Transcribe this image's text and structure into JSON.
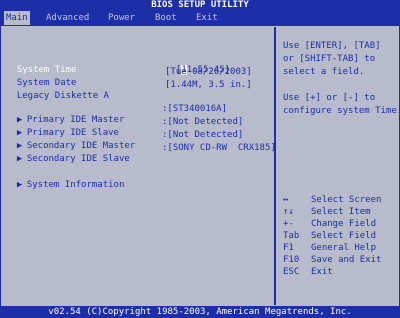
{
  "title": "BIOS SETUP UTILITY",
  "menu": [
    {
      "label": "Main",
      "active": true
    },
    {
      "label": "Advanced"
    },
    {
      "label": "Power"
    },
    {
      "label": "Boot"
    },
    {
      "label": "Exit"
    }
  ],
  "main": {
    "system_time_label": "System Time",
    "system_time_cursor": "1",
    "system_time_rest": "1:55:45",
    "system_date_label": "System Date",
    "system_date_value": "[Tue 08/26/2003]",
    "legacy_diskette_label": "Legacy Diskette A",
    "legacy_diskette_value": "[1.44M, 3.5 in.]",
    "ide": [
      {
        "label": "Primary IDE Master",
        "value": ":[ST340016A]"
      },
      {
        "label": "Primary IDE Slave",
        "value": ":[Not Detected]"
      },
      {
        "label": "Secondary IDE Master",
        "value": ":[Not Detected]"
      },
      {
        "label": "Secondary IDE Slave",
        "value": ":[SONY CD-RW  CRX185]"
      }
    ],
    "system_information_label": "System Information"
  },
  "help": {
    "line1": "Use [ENTER], [TAB]",
    "line2": "or [SHIFT-TAB] to",
    "line3": "select a field.",
    "line4": "Use [+] or [-] to",
    "line5": "configure system Time."
  },
  "keys": [
    {
      "key": "↔",
      "desc": "Select Screen"
    },
    {
      "key": "↑↓",
      "desc": "Select Item"
    },
    {
      "key": "+-",
      "desc": "Change Field"
    },
    {
      "key": "Tab",
      "desc": "Select Field"
    },
    {
      "key": "F1",
      "desc": "General Help"
    },
    {
      "key": "F10",
      "desc": "Save and Exit"
    },
    {
      "key": "ESC",
      "desc": "Exit"
    }
  ],
  "arrow_glyph": "▶",
  "footer": "v02.54 (C)Copyright 1985-2003, American Megatrends, Inc.",
  "colors": {
    "background": "#1c2fa8",
    "panel": "#b7bbcb",
    "text_white": "#ffffff"
  }
}
